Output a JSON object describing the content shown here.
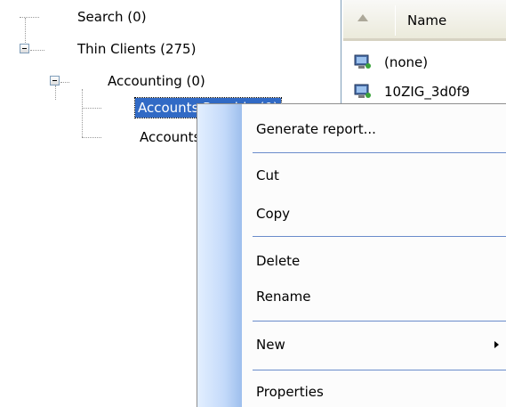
{
  "tree": {
    "items": [
      {
        "label": "Search (0)"
      },
      {
        "label": "Thin Clients (275)"
      },
      {
        "label": "Accounting (0)"
      },
      {
        "label": "Accounts Payable (0)"
      },
      {
        "label": "Accounts Receivable"
      }
    ]
  },
  "list": {
    "column_name": "Name",
    "rows": [
      {
        "name": "(none)"
      },
      {
        "name": "10ZIG_3d0f9"
      }
    ]
  },
  "context_menu": {
    "generate_report": "Generate report...",
    "cut": "Cut",
    "copy": "Copy",
    "delete": "Delete",
    "rename": "Rename",
    "new": "New",
    "properties": "Properties"
  },
  "colors": {
    "selection": "#316ac5",
    "menu_separator": "#6a8ccb",
    "menu_gutter": "#c4dafa"
  }
}
